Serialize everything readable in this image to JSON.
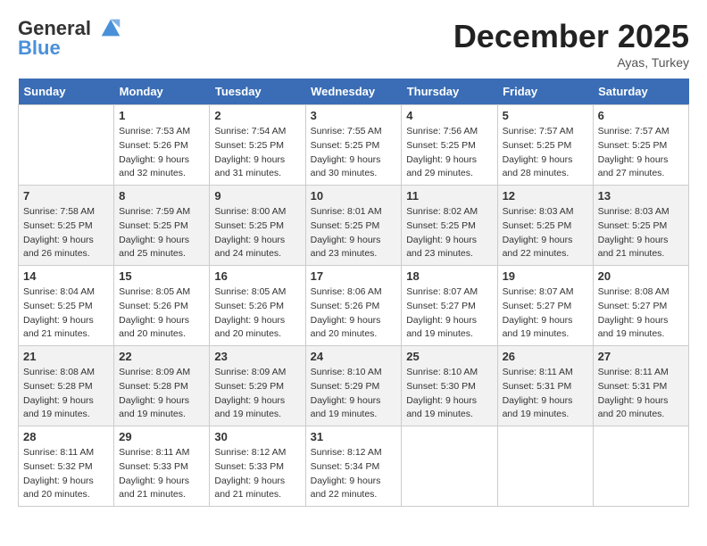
{
  "header": {
    "logo_line1": "General",
    "logo_line2": "Blue",
    "month_title": "December 2025",
    "location": "Ayas, Turkey"
  },
  "weekdays": [
    "Sunday",
    "Monday",
    "Tuesday",
    "Wednesday",
    "Thursday",
    "Friday",
    "Saturday"
  ],
  "weeks": [
    [
      {
        "day": "",
        "sunrise": "",
        "sunset": "",
        "daylight": ""
      },
      {
        "day": "1",
        "sunrise": "Sunrise: 7:53 AM",
        "sunset": "Sunset: 5:26 PM",
        "daylight": "Daylight: 9 hours and 32 minutes."
      },
      {
        "day": "2",
        "sunrise": "Sunrise: 7:54 AM",
        "sunset": "Sunset: 5:25 PM",
        "daylight": "Daylight: 9 hours and 31 minutes."
      },
      {
        "day": "3",
        "sunrise": "Sunrise: 7:55 AM",
        "sunset": "Sunset: 5:25 PM",
        "daylight": "Daylight: 9 hours and 30 minutes."
      },
      {
        "day": "4",
        "sunrise": "Sunrise: 7:56 AM",
        "sunset": "Sunset: 5:25 PM",
        "daylight": "Daylight: 9 hours and 29 minutes."
      },
      {
        "day": "5",
        "sunrise": "Sunrise: 7:57 AM",
        "sunset": "Sunset: 5:25 PM",
        "daylight": "Daylight: 9 hours and 28 minutes."
      },
      {
        "day": "6",
        "sunrise": "Sunrise: 7:57 AM",
        "sunset": "Sunset: 5:25 PM",
        "daylight": "Daylight: 9 hours and 27 minutes."
      }
    ],
    [
      {
        "day": "7",
        "sunrise": "Sunrise: 7:58 AM",
        "sunset": "Sunset: 5:25 PM",
        "daylight": "Daylight: 9 hours and 26 minutes."
      },
      {
        "day": "8",
        "sunrise": "Sunrise: 7:59 AM",
        "sunset": "Sunset: 5:25 PM",
        "daylight": "Daylight: 9 hours and 25 minutes."
      },
      {
        "day": "9",
        "sunrise": "Sunrise: 8:00 AM",
        "sunset": "Sunset: 5:25 PM",
        "daylight": "Daylight: 9 hours and 24 minutes."
      },
      {
        "day": "10",
        "sunrise": "Sunrise: 8:01 AM",
        "sunset": "Sunset: 5:25 PM",
        "daylight": "Daylight: 9 hours and 23 minutes."
      },
      {
        "day": "11",
        "sunrise": "Sunrise: 8:02 AM",
        "sunset": "Sunset: 5:25 PM",
        "daylight": "Daylight: 9 hours and 23 minutes."
      },
      {
        "day": "12",
        "sunrise": "Sunrise: 8:03 AM",
        "sunset": "Sunset: 5:25 PM",
        "daylight": "Daylight: 9 hours and 22 minutes."
      },
      {
        "day": "13",
        "sunrise": "Sunrise: 8:03 AM",
        "sunset": "Sunset: 5:25 PM",
        "daylight": "Daylight: 9 hours and 21 minutes."
      }
    ],
    [
      {
        "day": "14",
        "sunrise": "Sunrise: 8:04 AM",
        "sunset": "Sunset: 5:25 PM",
        "daylight": "Daylight: 9 hours and 21 minutes."
      },
      {
        "day": "15",
        "sunrise": "Sunrise: 8:05 AM",
        "sunset": "Sunset: 5:26 PM",
        "daylight": "Daylight: 9 hours and 20 minutes."
      },
      {
        "day": "16",
        "sunrise": "Sunrise: 8:05 AM",
        "sunset": "Sunset: 5:26 PM",
        "daylight": "Daylight: 9 hours and 20 minutes."
      },
      {
        "day": "17",
        "sunrise": "Sunrise: 8:06 AM",
        "sunset": "Sunset: 5:26 PM",
        "daylight": "Daylight: 9 hours and 20 minutes."
      },
      {
        "day": "18",
        "sunrise": "Sunrise: 8:07 AM",
        "sunset": "Sunset: 5:27 PM",
        "daylight": "Daylight: 9 hours and 19 minutes."
      },
      {
        "day": "19",
        "sunrise": "Sunrise: 8:07 AM",
        "sunset": "Sunset: 5:27 PM",
        "daylight": "Daylight: 9 hours and 19 minutes."
      },
      {
        "day": "20",
        "sunrise": "Sunrise: 8:08 AM",
        "sunset": "Sunset: 5:27 PM",
        "daylight": "Daylight: 9 hours and 19 minutes."
      }
    ],
    [
      {
        "day": "21",
        "sunrise": "Sunrise: 8:08 AM",
        "sunset": "Sunset: 5:28 PM",
        "daylight": "Daylight: 9 hours and 19 minutes."
      },
      {
        "day": "22",
        "sunrise": "Sunrise: 8:09 AM",
        "sunset": "Sunset: 5:28 PM",
        "daylight": "Daylight: 9 hours and 19 minutes."
      },
      {
        "day": "23",
        "sunrise": "Sunrise: 8:09 AM",
        "sunset": "Sunset: 5:29 PM",
        "daylight": "Daylight: 9 hours and 19 minutes."
      },
      {
        "day": "24",
        "sunrise": "Sunrise: 8:10 AM",
        "sunset": "Sunset: 5:29 PM",
        "daylight": "Daylight: 9 hours and 19 minutes."
      },
      {
        "day": "25",
        "sunrise": "Sunrise: 8:10 AM",
        "sunset": "Sunset: 5:30 PM",
        "daylight": "Daylight: 9 hours and 19 minutes."
      },
      {
        "day": "26",
        "sunrise": "Sunrise: 8:11 AM",
        "sunset": "Sunset: 5:31 PM",
        "daylight": "Daylight: 9 hours and 19 minutes."
      },
      {
        "day": "27",
        "sunrise": "Sunrise: 8:11 AM",
        "sunset": "Sunset: 5:31 PM",
        "daylight": "Daylight: 9 hours and 20 minutes."
      }
    ],
    [
      {
        "day": "28",
        "sunrise": "Sunrise: 8:11 AM",
        "sunset": "Sunset: 5:32 PM",
        "daylight": "Daylight: 9 hours and 20 minutes."
      },
      {
        "day": "29",
        "sunrise": "Sunrise: 8:11 AM",
        "sunset": "Sunset: 5:33 PM",
        "daylight": "Daylight: 9 hours and 21 minutes."
      },
      {
        "day": "30",
        "sunrise": "Sunrise: 8:12 AM",
        "sunset": "Sunset: 5:33 PM",
        "daylight": "Daylight: 9 hours and 21 minutes."
      },
      {
        "day": "31",
        "sunrise": "Sunrise: 8:12 AM",
        "sunset": "Sunset: 5:34 PM",
        "daylight": "Daylight: 9 hours and 22 minutes."
      },
      {
        "day": "",
        "sunrise": "",
        "sunset": "",
        "daylight": ""
      },
      {
        "day": "",
        "sunrise": "",
        "sunset": "",
        "daylight": ""
      },
      {
        "day": "",
        "sunrise": "",
        "sunset": "",
        "daylight": ""
      }
    ]
  ]
}
